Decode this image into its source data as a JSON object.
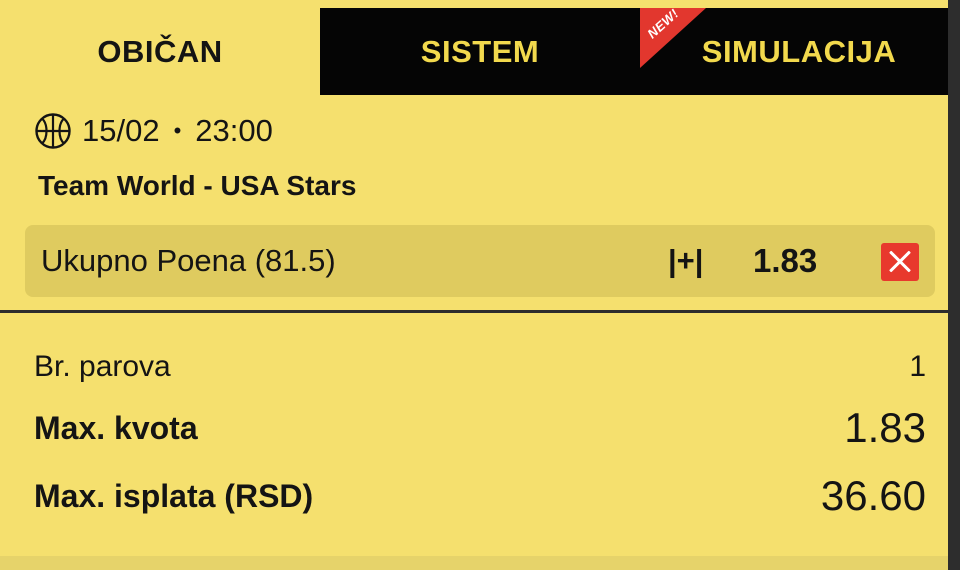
{
  "tabs": [
    {
      "label": "OBIČAN",
      "active": true
    },
    {
      "label": "SISTEM",
      "active": false
    },
    {
      "label": "SIMULACIJA",
      "active": false,
      "badge": "NEW!"
    }
  ],
  "event": {
    "sport_icon": "basketball-icon",
    "date": "15/02",
    "separator": "•",
    "time": "23:00",
    "match": "Team World - USA Stars"
  },
  "selection": {
    "market": "Ukupno Poena (81.5)",
    "pick": "|+|",
    "odd": "1.83",
    "remove_icon": "close-icon"
  },
  "summary": {
    "pairs_label": "Br. parova",
    "pairs_value": "1",
    "max_quota_label": "Max. kvota",
    "max_quota_value": "1.83",
    "max_payout_label": "Max. isplata (RSD)",
    "max_payout_value": "36.60"
  },
  "colors": {
    "background": "#f5e06e",
    "tab_dark": "#050505",
    "tab_text_inactive": "#f2d94d",
    "row_highlight": "#dfcb5f",
    "remove_red": "#e8392d",
    "new_badge": "#e2372e"
  }
}
